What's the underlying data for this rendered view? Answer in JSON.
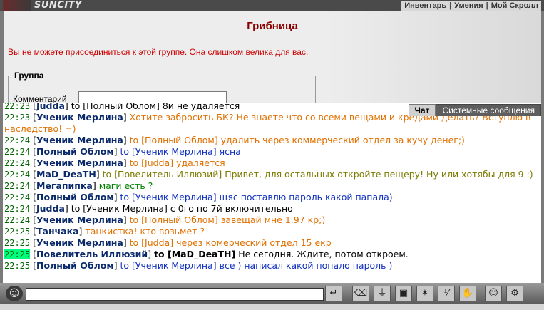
{
  "app": {
    "logo_text": "SUNCITY"
  },
  "top_menu": [
    "Инвентарь",
    "Умения",
    "Мой Скролл"
  ],
  "page": {
    "title": "Грибница",
    "warning": "Вы не можете присоединиться к этой группе. Она слишком велика для вас.",
    "group_legend": "Группа",
    "comment_label": "Комментарий",
    "comment_value": ""
  },
  "tabs": [
    "Чат",
    "Системные сообщения"
  ],
  "chat": [
    {
      "time": "22:23",
      "nick": "Judda",
      "to": "to [Полный Облом]",
      "text": "8и не удаляется",
      "color": "#000000",
      "hl": false
    },
    {
      "time": "22:23",
      "nick": "Ученик Мерлина",
      "to": "",
      "text": "Хотите забросить БК? Не знаете что со всеми вещами и кредами делать? Вступлю в наследство! =)",
      "color": "#e07000",
      "hl": false
    },
    {
      "time": "22:24",
      "nick": "Ученик Мерлина",
      "to": "to [Полный Облом]",
      "text": "удалить через коммерческий отдел за кучу денег;)",
      "color": "#e07000",
      "hl": false
    },
    {
      "time": "22:24",
      "nick": "Полный Облом",
      "to": "to [Ученик Мерлина]",
      "text": "ясна",
      "color": "#1030c0",
      "hl": false
    },
    {
      "time": "22:24",
      "nick": "Ученик Мерлина",
      "to": "to [Judda]",
      "text": "удаляется",
      "color": "#e07000",
      "hl": false
    },
    {
      "time": "22:24",
      "nick": "MaD_DeaTH",
      "to": "to [Повелитель Иллюзий]",
      "text": "Привет, для остальных откройте пещеру! Ну или хотябы для 9 :)",
      "color": "#7a7a00",
      "hl": false
    },
    {
      "time": "22:24",
      "nick": "Мегапипка",
      "to": "",
      "text": "маги есть ?",
      "color": "#008000",
      "hl": false
    },
    {
      "time": "22:24",
      "nick": "Полный Облом",
      "to": "to [Ученик Мерлина]",
      "text": "щяс поставлю пароль какой папала)",
      "color": "#1030c0",
      "hl": false
    },
    {
      "time": "22:24",
      "nick": "Judda",
      "to": "to [Ученик Мерлина]",
      "text": "с 0го по 7й включительно",
      "color": "#000000",
      "hl": false
    },
    {
      "time": "22:24",
      "nick": "Ученик Мерлина",
      "to": "to [Полный Облом]",
      "text": "завещай мне 1.97 кр;)",
      "color": "#e07000",
      "hl": false
    },
    {
      "time": "22:25",
      "nick": "Танчака",
      "to": "",
      "text": "танкистка! кто возьмет ?",
      "color": "#e07000",
      "hl": false
    },
    {
      "time": "22:25",
      "nick": "Ученик Мерлина",
      "to": "to [Judda]",
      "text": "через комерческий отдел 15 екр",
      "color": "#e07000",
      "hl": false
    },
    {
      "time": "22:25",
      "nick": "Повелитель Иллюзий",
      "to": "to [MaD_DeaTH]",
      "text": "Не сегодня. Ждите, потом откроем.",
      "color": "#000000",
      "hl": true
    },
    {
      "time": "22:25",
      "nick": "Полный Облом",
      "to": "to [Ученик Мерлина]",
      "text": "все ) написал какой попало пароль )",
      "color": "#1030c0",
      "hl": false
    }
  ],
  "bottom": {
    "message_value": "",
    "icons": [
      "face-icon",
      "enter-icon",
      "eraser-icon",
      "filter-icon",
      "save-icon",
      "fight-icon",
      "parity-icon",
      "hand-icon",
      "smile-icon",
      "settings-icon"
    ]
  }
}
